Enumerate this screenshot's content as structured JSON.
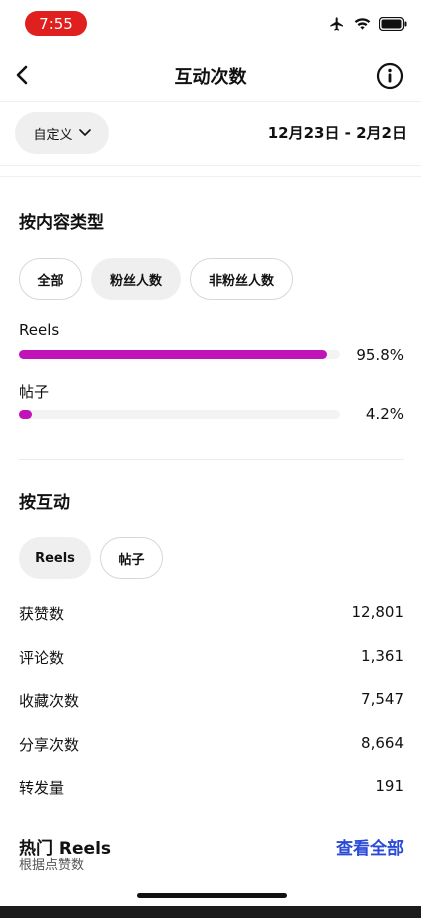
{
  "status_bar": {
    "time": "7:55"
  },
  "nav": {
    "title": "互动次数"
  },
  "filter": {
    "range_dropdown": "自定义",
    "date_range": "12月23日 - 2月2日"
  },
  "content_type": {
    "title": "按内容类型",
    "chips": [
      "全部",
      "粉丝人数",
      "非粉丝人数"
    ],
    "bars": [
      {
        "label": "Reels",
        "value": 0.958,
        "pct_text": "95.8%"
      },
      {
        "label": "帖子",
        "value": 0.042,
        "pct_text": "4.2%"
      }
    ],
    "bar_color": "#c013b8"
  },
  "by_interaction": {
    "title": "按互动",
    "tabs": [
      "Reels",
      "帖子"
    ],
    "selected_tab": "Reels",
    "metrics": [
      {
        "label": "获赞数",
        "value": "12,801"
      },
      {
        "label": "评论数",
        "value": "1,361"
      },
      {
        "label": "收藏次数",
        "value": "7,547"
      },
      {
        "label": "分享次数",
        "value": "8,664"
      },
      {
        "label": "转发量",
        "value": "191"
      }
    ]
  },
  "hot_reels": {
    "title": "热门 Reels",
    "subtitle": "根据点赞数",
    "view_all": "查看全部",
    "link_color": "#2a4bd7"
  }
}
